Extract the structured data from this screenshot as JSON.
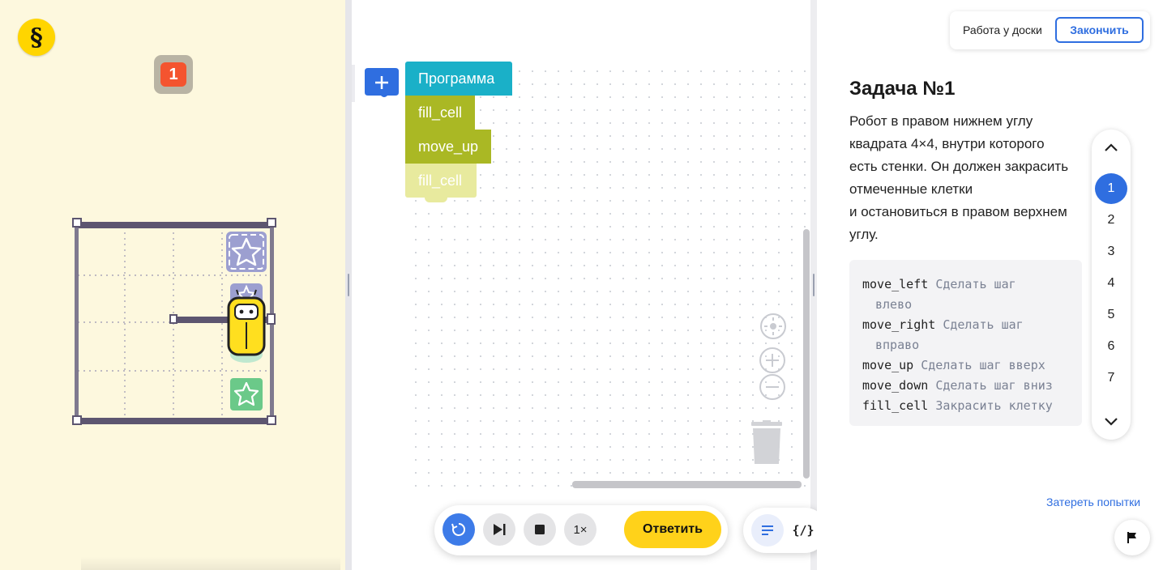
{
  "logo": {
    "glyph": "§",
    "icon": "section-sign-logo",
    "color": "#ffd500"
  },
  "attempt": {
    "count": "1",
    "color": "#f4542f"
  },
  "field": {
    "rows": 4,
    "cols": 4,
    "robot": {
      "row": 2,
      "col": 4,
      "color": "#ffdf1f"
    },
    "stars": [
      {
        "row": 1,
        "col": 4,
        "color": "#9c9fd0"
      },
      {
        "row": 4,
        "col": 4,
        "color": "#6bc989"
      }
    ],
    "walls": [
      {
        "row": 2,
        "from_col": 3,
        "to_col": 4,
        "side": "bottom",
        "label": "inner-wall"
      }
    ]
  },
  "workspace": {
    "add_icon": "plus-icon",
    "blocks": [
      {
        "label": "Программа",
        "kind": "program",
        "color": "#1ab0c8"
      },
      {
        "label": "fill_cell",
        "kind": "command",
        "color": "#aab824"
      },
      {
        "label": "move_up",
        "kind": "command",
        "color": "#aab824"
      },
      {
        "label": "fill_cell",
        "kind": "command-ghost",
        "color": "#e8ea9e"
      }
    ],
    "tools": [
      "center-icon",
      "zoom-in-icon",
      "zoom-out-icon",
      "trash-icon"
    ]
  },
  "controls": {
    "speed_label": "1×",
    "answer_label": "Ответить",
    "accent": "#3d7be8",
    "answer_color": "#ffd21a",
    "code_toggle_label": "{/}"
  },
  "header": {
    "board_label": "Работа у доски",
    "finish_label": "Закончить"
  },
  "task": {
    "title": "Задача №1",
    "lines": [
      "Робот в правом нижнем углу",
      "квадрата 4×4, внутри которого",
      "есть стенки. Он должен закрасить",
      "отмеченные клетки",
      "и остановиться в правом верхнем",
      "углу."
    ],
    "commands": [
      {
        "name": "move_left",
        "desc": "Сделать шаг",
        "cont": "влево"
      },
      {
        "name": "move_right",
        "desc": "Сделать шаг",
        "cont": "вправо"
      },
      {
        "name": "move_up",
        "desc": "Сделать шаг вверх",
        "cont": ""
      },
      {
        "name": "move_down",
        "desc": "Сделать шаг вниз",
        "cont": ""
      },
      {
        "name": "fill_cell",
        "desc": "Закрасить клетку",
        "cont": ""
      }
    ]
  },
  "task_nav": {
    "items": [
      "1",
      "2",
      "3",
      "4",
      "5",
      "6",
      "7"
    ],
    "active": "1"
  },
  "reset_attempts_label": "Затереть попытки",
  "flag_icon": "flag-icon"
}
